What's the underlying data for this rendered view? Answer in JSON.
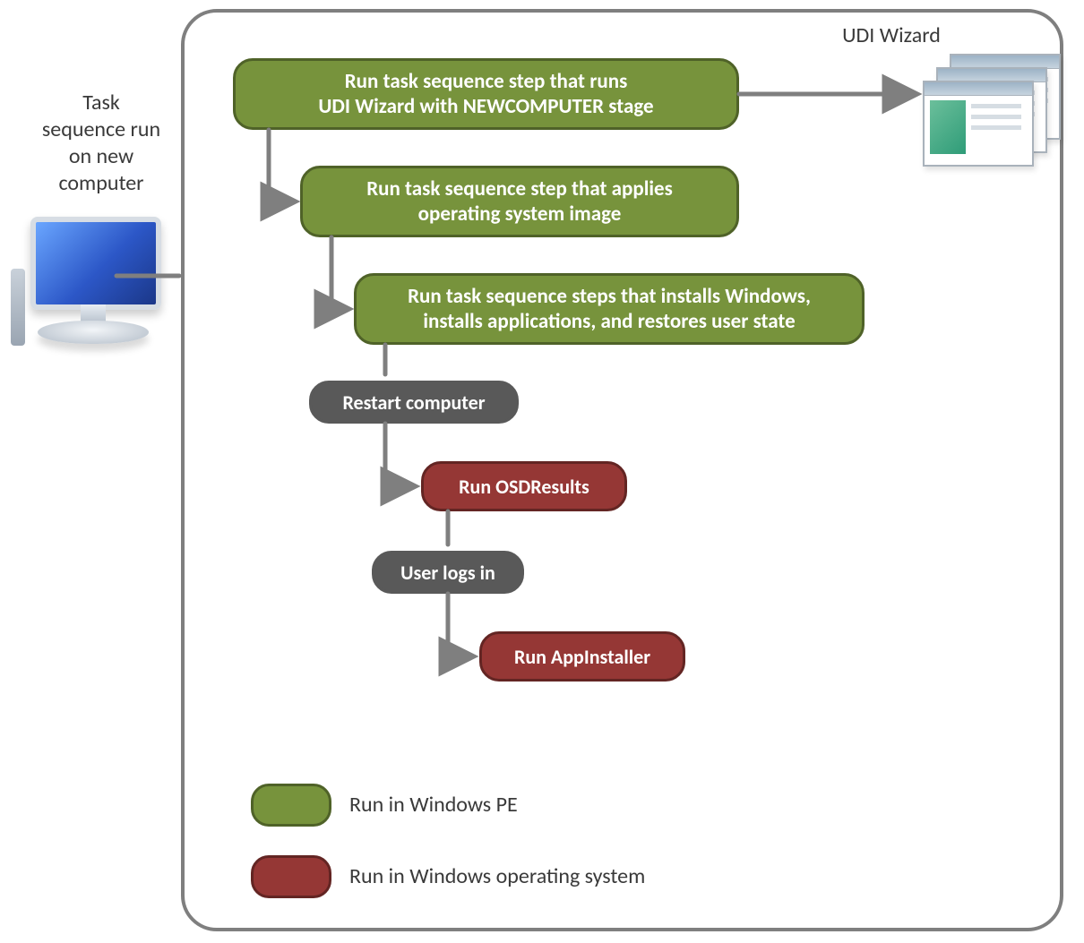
{
  "labels": {
    "task_sequence": "Task\nsequence run\non new\ncomputer",
    "udi_wizard": "UDI Wizard"
  },
  "steps": {
    "s1": "Run task sequence step  that runs\nUDI Wizard with NEWCOMPUTER  stage",
    "s2": "Run  task sequence step that applies\noperating system image",
    "s3": "Run task sequence steps that installs Windows,\ninstalls applications, and restores user state",
    "s4": "Restart computer",
    "s5": "Run OSDResults",
    "s6": "User logs in",
    "s7": "Run AppInstaller"
  },
  "legend": {
    "pe": "Run in Windows  PE",
    "os": "Run in Windows operating system"
  },
  "colors": {
    "green_fill": "#77933c",
    "green_border": "#4f6228",
    "gray_fill": "#595959",
    "red_fill": "#953735",
    "red_border": "#632523",
    "frame": "#7f7f7f"
  }
}
